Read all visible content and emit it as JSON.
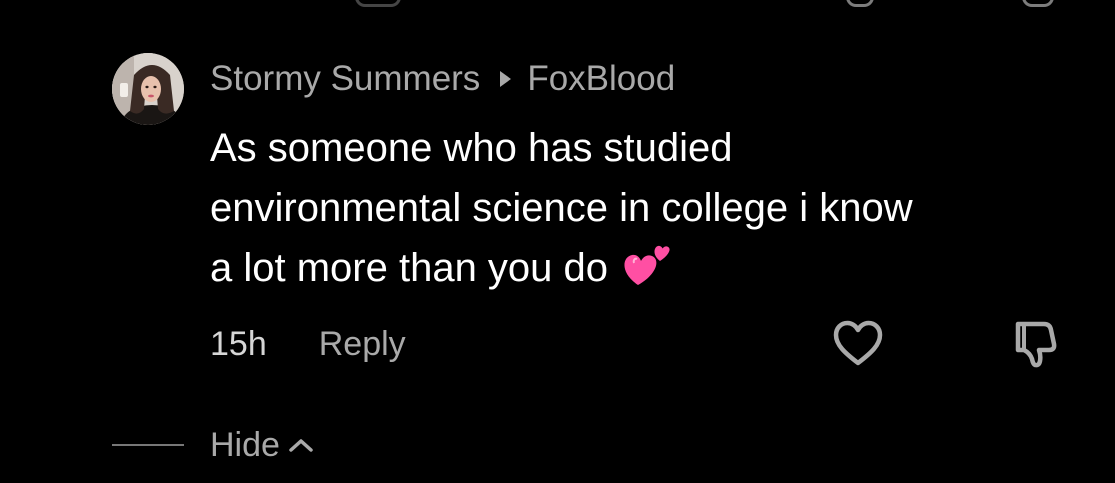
{
  "comment": {
    "author": "Stormy Summers",
    "reply_to": "FoxBlood",
    "text_lines": [
      "As someone who has studied",
      "environmental science in college i know",
      "a lot more than you do"
    ],
    "emoji": "two-hearts",
    "timestamp": "15h",
    "reply_label": "Reply"
  },
  "thread": {
    "hide_label": "Hide"
  },
  "icons": {
    "like": "heart-icon",
    "dislike": "thumbs-down-icon",
    "reply_arrow": "triangle-right-icon",
    "collapse": "chevron-up-icon"
  },
  "colors": {
    "background": "#000000",
    "primary_text": "#ffffff",
    "secondary_text": "#a9a9a9",
    "emoji_pink": "#ff4fa3"
  }
}
